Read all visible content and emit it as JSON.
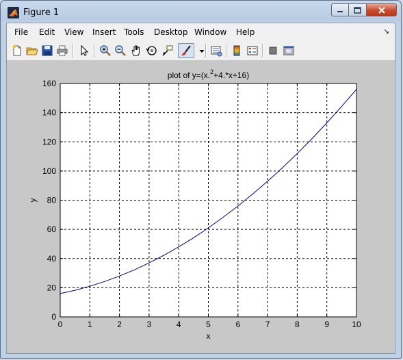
{
  "window": {
    "title": "Figure 1"
  },
  "menu": [
    "File",
    "Edit",
    "View",
    "Insert",
    "Tools",
    "Desktop",
    "Window",
    "Help"
  ],
  "toolbar": {
    "icons": [
      "new-figure-icon",
      "open-file-icon",
      "save-icon",
      "print-icon",
      "edit-plot-arrow-icon",
      "zoom-in-icon",
      "zoom-out-icon",
      "pan-hand-icon",
      "rotate-3d-icon",
      "data-cursor-icon",
      "brush-icon",
      "brush-dropdown-icon",
      "link-plot-icon",
      "insert-colorbar-icon",
      "insert-legend-icon",
      "hide-plot-tools-icon",
      "show-plot-tools-icon"
    ]
  },
  "chart_data": {
    "type": "line",
    "title_main": "plot of y=(x.",
    "title_sup": "2",
    "title_rest": "+4.*x+16)",
    "xlabel": "x",
    "ylabel": "y",
    "xlim": [
      0,
      10
    ],
    "ylim": [
      0,
      160
    ],
    "xticks": [
      0,
      1,
      2,
      3,
      4,
      5,
      6,
      7,
      8,
      9,
      10
    ],
    "yticks": [
      0,
      20,
      40,
      60,
      80,
      100,
      120,
      140,
      160
    ],
    "grid": true,
    "line_color": "#00007f",
    "series": [
      {
        "x": [
          0,
          0.5,
          1,
          1.5,
          2,
          2.5,
          3,
          3.5,
          4,
          4.5,
          5,
          5.5,
          6,
          6.5,
          7,
          7.5,
          8,
          8.5,
          9,
          9.5,
          10
        ],
        "y": [
          16,
          18.25,
          21,
          24.25,
          28,
          32.25,
          37,
          42.25,
          48,
          54.25,
          61,
          68.25,
          76,
          84.25,
          93,
          102.25,
          112,
          122.25,
          133,
          144.25,
          156
        ]
      }
    ]
  }
}
